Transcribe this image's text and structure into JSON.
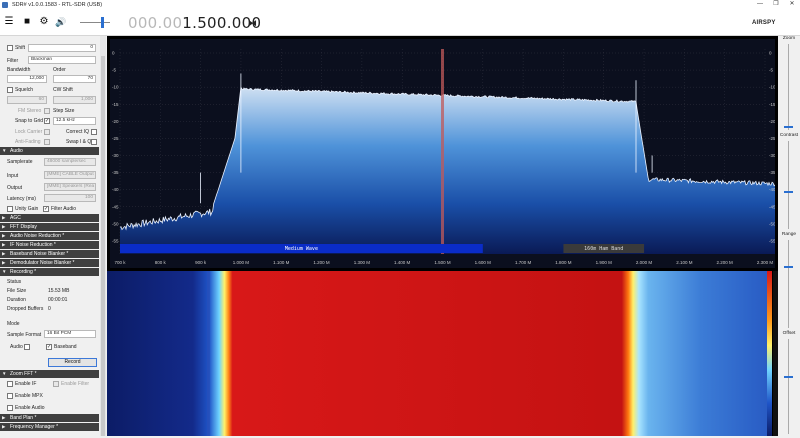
{
  "window": {
    "title": "SDR# v1.0.0.1583 - RTL-SDR (USB)",
    "min": "—",
    "restore": "❐",
    "close": "✕"
  },
  "toolbar": {
    "menu_icon": "☰",
    "stop_icon": "■",
    "settings_icon": "⚙",
    "audio_icon": "🔊",
    "freq_dim": "000.00",
    "freq_lit": "1.500.000",
    "swap_icon": "⧓",
    "logo": "AIRSPY"
  },
  "panel": {
    "shift_label": "Shift",
    "shift_value": "0",
    "filter_label": "Filter",
    "filter_value": "Blackman",
    "bandwidth_label": "Bandwidth",
    "order_label": "Order",
    "bandwidth_value": "12,000",
    "order_value": "70",
    "squelch_label": "Squelch",
    "cw_shift_label": "CW Shift",
    "squelch_value": "60",
    "cw_shift_value": "1,000",
    "fm_stereo_label": "FM Stereo",
    "step_size_label": "Step Size",
    "snap_label": "Snap to Grid",
    "step_value": "12.5 kHz",
    "lock_carrier_label": "Lock Carrier",
    "correct_iq_label": "Correct IQ",
    "anti_fading_label": "Anti-Fading",
    "swap_iq_label": "Swap I & Q",
    "audio_section": "Audio",
    "samplerate_label": "Samplerate",
    "samplerate_value": "48000 sample/sec",
    "input_label": "Input",
    "input_value": "[MME] CABLE Output",
    "output_label": "Output",
    "output_value": "[MME] Speakers (Rea",
    "latency_label": "Latency (ms)",
    "latency_value": "100",
    "unity_gain_label": "Unity Gain",
    "filter_audio_label": "Filter Audio",
    "sections": [
      "AGC",
      "FFT Display",
      "Audio Noise Reduction *",
      "IF Noise Reduction *",
      "Baseband Noise Blanker *",
      "Demodulator Noise Blanker *"
    ],
    "recording_section": "Recording *",
    "status_label": "Status",
    "file_size_label": "File Size",
    "file_size_value": "15.53 MB",
    "duration_label": "Duration",
    "duration_value": "00:00:01",
    "dropped_label": "Dropped Buffers",
    "dropped_value": "0",
    "mode_label": "Mode",
    "sample_format_label": "Sample Format",
    "sample_format_value": "16 Bit PCM",
    "audio_label": "Audio",
    "baseband_label": "Baseband",
    "record_button": "Record",
    "zoom_fft_section": "Zoom FFT *",
    "enable_if_label": "Enable IF",
    "enable_filter_label": "Enable Filter",
    "enable_mpx_label": "Enable MPX",
    "enable_audio_label": "Enable Audio",
    "band_plan_section": "Band Plan *",
    "freq_manager_section": "Frequency Manager *"
  },
  "right_panel": {
    "zoom": "Zoom",
    "contrast": "Contrast",
    "range": "Range",
    "offset": "Offset"
  },
  "spectrum": {
    "y_ticks": [
      "0",
      "-5",
      "-10",
      "-15",
      "-20",
      "-25",
      "-30",
      "-35",
      "-40",
      "-45",
      "-50",
      "-55"
    ],
    "x_ticks": [
      "700 k",
      "800 k",
      "900 k",
      "1.000 M",
      "1.100 M",
      "1.200 M",
      "1.300 M",
      "1.400 M",
      "1.500 M",
      "1.600 M",
      "1.700 M",
      "1.800 M",
      "1.900 M",
      "2.000 M",
      "2.100 M",
      "2.200 M",
      "2.300 M"
    ],
    "band_medium_wave": "Medium Wave",
    "band_160m": "160m Ham Band",
    "fill_color": "#2f7fd6",
    "band_color": "#0a2cc8",
    "tuned_color": "#c05a5a"
  }
}
